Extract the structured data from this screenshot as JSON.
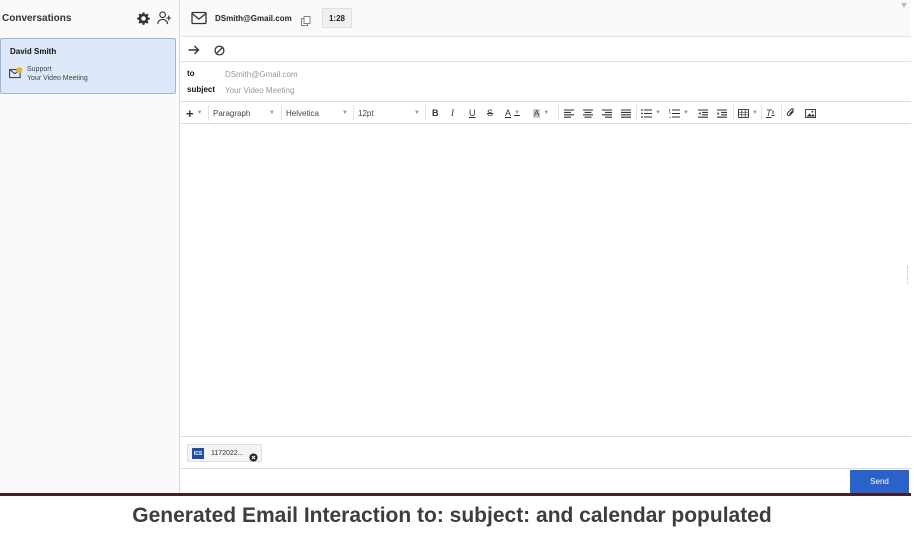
{
  "sidebar": {
    "title": "Conversations",
    "icons": [
      "gear-icon",
      "add-person-icon"
    ],
    "conversation": {
      "name": "David Smith",
      "line1": "Support",
      "line2": "Your Video Meeting",
      "icon": "mail-icon",
      "badge_color": "#f2b416"
    }
  },
  "header": {
    "address": "DSmith@Gmail.com",
    "timer": "1:28",
    "icons": [
      "mail-icon",
      "copy-icon"
    ]
  },
  "actions": {
    "icons": [
      "forward-arrow-icon",
      "cancel-icon"
    ]
  },
  "fields": {
    "to_label": "to",
    "to_value": "DSmith@Gmail.com",
    "subject_label": "subject",
    "subject_value": "Your Video Meeting"
  },
  "toolbar": {
    "format": "Paragraph",
    "font": "Helvetica",
    "size": "12pt"
  },
  "attachment": {
    "type_label": "ICS",
    "name": "1172022..."
  },
  "footer": {
    "send_label": "Send"
  },
  "caption": "Generated Email Interaction to: subject: and calendar populated",
  "colors": {
    "accent": "#2a62c9",
    "selected_bg": "#dde9fb",
    "rule": "#4a1e23"
  }
}
